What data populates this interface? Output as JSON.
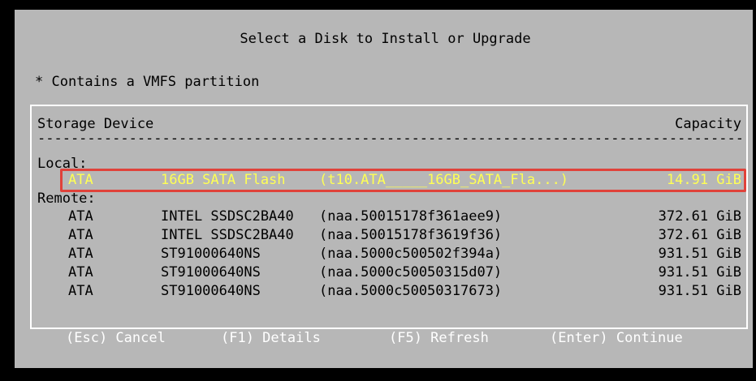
{
  "dialog": {
    "title": "Select a Disk to Install or Upgrade",
    "legend": "* Contains a VMFS partition"
  },
  "table": {
    "header_device": "Storage Device",
    "header_capacity": "Capacity",
    "divider": "----------------------------------------------------------------------------------------------------------",
    "local_label": "Local:",
    "remote_label": "Remote:",
    "local": [
      {
        "vendor": "ATA",
        "model": "16GB SATA Flash",
        "id": "(t10.ATA_____16GB_SATA_Fla...)",
        "capacity": "14.91 GiB"
      }
    ],
    "remote": [
      {
        "vendor": "ATA",
        "model": "INTEL SSDSC2BA40",
        "id": "(naa.50015178f361aee9)",
        "capacity": "372.61 GiB"
      },
      {
        "vendor": "ATA",
        "model": "INTEL SSDSC2BA40",
        "id": "(naa.50015178f3619f36)",
        "capacity": "372.61 GiB"
      },
      {
        "vendor": "ATA",
        "model": "ST91000640NS",
        "id": "(naa.5000c500502f394a)",
        "capacity": "931.51 GiB"
      },
      {
        "vendor": "ATA",
        "model": "ST91000640NS",
        "id": "(naa.5000c50050315d07)",
        "capacity": "931.51 GiB"
      },
      {
        "vendor": "ATA",
        "model": "ST91000640NS",
        "id": "(naa.5000c50050317673)",
        "capacity": "931.51 GiB"
      }
    ]
  },
  "footer": {
    "cancel": "(Esc) Cancel",
    "details": "(F1) Details",
    "refresh": "(F5) Refresh",
    "continue": "(Enter) Continue"
  },
  "colors": {
    "dialog_bg": "#b7b7b7",
    "selected_text": "#ffff54",
    "highlight_frame": "#e0423a",
    "footer_text": "#ffffff"
  }
}
